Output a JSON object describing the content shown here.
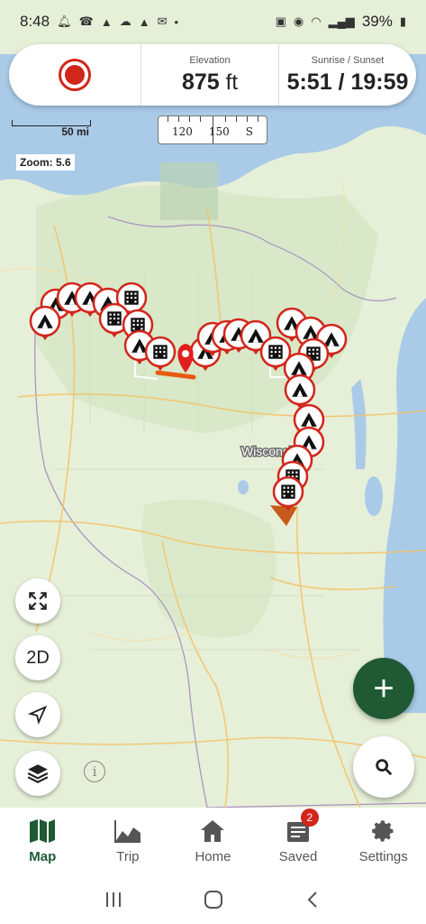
{
  "status_bar": {
    "time": "8:48",
    "battery": "39%"
  },
  "info_card": {
    "elevation_label": "Elevation",
    "elevation_value": "875",
    "elevation_unit": "ft",
    "sun_label": "Sunrise / Sunset",
    "sun_value": "5:51 / 19:59"
  },
  "map": {
    "scale_label": "50 mi",
    "zoom_label": "Zoom: 5.6",
    "place_label": "Wisconsin",
    "compass": {
      "t1": "120",
      "t2": "150",
      "t3": "S"
    }
  },
  "controls": {
    "view_mode": "2D"
  },
  "tabs": [
    {
      "label": "Map"
    },
    {
      "label": "Trip"
    },
    {
      "label": "Home"
    },
    {
      "label": "Saved",
      "badge": "2"
    },
    {
      "label": "Settings"
    }
  ],
  "colors": {
    "brand_green": "#1f5a35",
    "record_red": "#d2261b",
    "route_orange": "#e85a10",
    "water": "#a9cbe8",
    "land": "#e6efd8"
  }
}
